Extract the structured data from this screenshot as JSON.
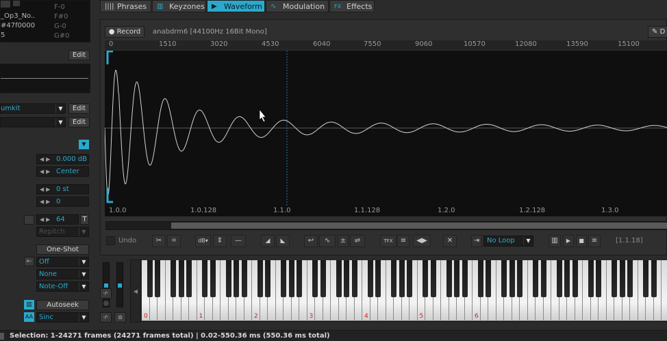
{
  "left_panel": {
    "sample_name": "_Op3_No..",
    "sample_color": "#47f0000",
    "sample_num": "5",
    "notes": [
      "F-0",
      "F#0",
      "G-0",
      "G#0"
    ],
    "edit1": "Edit",
    "drumkit": "umkit",
    "edit2": "Edit",
    "edit3": "Edit",
    "volume": "0.000 dB",
    "panning": "Center",
    "transpose": "0 st",
    "finetune": "0",
    "beat_sync": "64",
    "beat_sync_toggle": "T",
    "repitch": "Repitch",
    "oneshot": "One-Shot",
    "nna": "Off",
    "loop_release": "None",
    "note_off": "Note-Off",
    "autoseek": "Autoseek",
    "aa_label": "AA",
    "interp": "Sinc"
  },
  "tabs": [
    {
      "label": "Phrases",
      "icon": "phrases-icon",
      "glyph": "||||"
    },
    {
      "label": "Keyzones",
      "icon": "keyzones-icon",
      "glyph": "▥"
    },
    {
      "label": "Waveform",
      "icon": "waveform-icon",
      "glyph": "▶"
    },
    {
      "label": "Modulation",
      "icon": "modulation-icon",
      "glyph": "∿"
    },
    {
      "label": "Effects",
      "icon": "effects-icon",
      "glyph": "FX"
    }
  ],
  "waveform": {
    "record": "Record",
    "sample_info": "anabdrm6 [44100Hz 16Bit Mono]",
    "draw_label": "D",
    "ruler": [
      "0",
      "1510",
      "3020",
      "4530",
      "6040",
      "7550",
      "9060",
      "10570",
      "12080",
      "13590",
      "15100"
    ],
    "beats": [
      "1.0.0",
      "1.0.128",
      "1.1.0",
      "1.1.128",
      "1.2.0",
      "1.2.128",
      "1.3.0"
    ]
  },
  "toolbar": {
    "undo": "Undo",
    "db_label": "dB",
    "tfx": "TFX",
    "loop_mode": "No Loop",
    "position": "[1.1.18]"
  },
  "keyboard": {
    "octaves": [
      "0",
      "1",
      "2",
      "3",
      "4",
      "5",
      "6"
    ],
    "button_a": "-/-",
    "button_b": "-/-"
  },
  "status": {
    "text": "Selection: 1-24271 frames (24271 frames total) | 0.02-550.36 ms (550.36 ms total)"
  },
  "colors": {
    "accent": "#2ba9cc",
    "background": "#2b2b2b",
    "waveform_bg": "#0f0f0f",
    "octave_label": "#d42020"
  }
}
